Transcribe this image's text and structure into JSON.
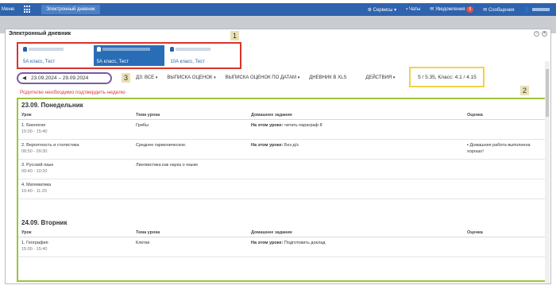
{
  "topbar": {
    "menu_label": "Меню",
    "app_tab": "Электронный дневник",
    "services": "Сервисы",
    "chats": "Чаты",
    "notifications": "Уведомления",
    "notifications_count": "6",
    "messages": "Сообщения"
  },
  "window": {
    "title": "Электронный дневник"
  },
  "cards": [
    {
      "class": "5А класс, Тест",
      "active": false
    },
    {
      "class": "5А класс, Тест",
      "active": true
    },
    {
      "class": "10А класс, Тест",
      "active": false
    }
  ],
  "labels": {
    "one": "1",
    "two": "2",
    "three": "3"
  },
  "toolbar": {
    "week": "23.09.2024 – 29.09.2024",
    "homework": "ДЗ: ВСЕ",
    "grades_extract": "ВЫПИСКА ОЦЕНОК",
    "grades_by_date": "ВЫПИСКА ОЦЕНОК ПО ДАТАМ",
    "xls": "ДНЕВНИК В XLS",
    "actions": "ДЕЙСТВИЯ",
    "average": "5 / 5.35, Класс: 4.1 / 4.15"
  },
  "notice": "Родителю необходимо подтвердить неделю",
  "columns": {
    "lesson": "Урок",
    "topic": "Тема урока",
    "homework": "Домашнее задание",
    "grade": "Оценка"
  },
  "days": [
    {
      "title": "23.09. Понедельник",
      "rows": [
        {
          "lesson": "1. Биология",
          "time": "15:00 - 15:40",
          "topic": "Грибы",
          "hw_label": "На этом уроке:",
          "hw_text": "читать параграф 8",
          "grade_1": "",
          "grade_2": ""
        },
        {
          "lesson": "2. Вероятность и статистика",
          "time": "08:50 - 09:30",
          "topic": "Среднее гармоническое.",
          "hw_label": "На этом уроке:",
          "hw_text": "Без д/з",
          "grade_1": "Домашняя работа выполнена",
          "grade_2": "хорошо!"
        },
        {
          "lesson": "3. Русский язык",
          "time": "09:40 - 10:20",
          "topic": "Лингвистика как наука о языке",
          "hw_label": "",
          "hw_text": "",
          "grade_1": "",
          "grade_2": ""
        },
        {
          "lesson": "4. Математика",
          "time": "10:40 - 11:20",
          "topic": "",
          "hw_label": "",
          "hw_text": "",
          "grade_1": "",
          "grade_2": ""
        }
      ]
    },
    {
      "title": "24.09. Вторник",
      "rows": [
        {
          "lesson": "1. География",
          "time": "15:00 - 15:40",
          "topic": "Клетки",
          "hw_label": "На этом уроке:",
          "hw_text": "Подготовить доклад",
          "grade_1": "",
          "grade_2": ""
        }
      ]
    }
  ]
}
